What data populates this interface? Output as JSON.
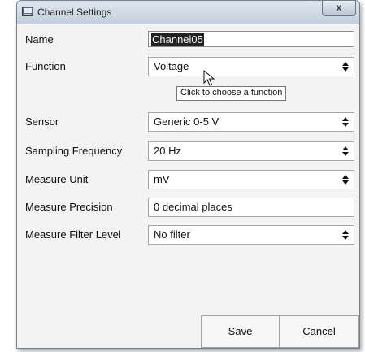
{
  "window": {
    "title": "Channel Settings",
    "close_label": "x"
  },
  "form": {
    "name_label": "Name",
    "name_value": "Channel05",
    "function_label": "Function",
    "function_value": "Voltage",
    "function_tooltip": "Click to choose a function",
    "sensor_label": "Sensor",
    "sensor_value": "Generic 0-5 V",
    "sampling_label": "Sampling Frequency",
    "sampling_value": "20 Hz",
    "unit_label": "Measure Unit",
    "unit_value": "mV",
    "precision_label": "Measure Precision",
    "precision_value": "0 decimal places",
    "filter_label": "Measure Filter Level",
    "filter_value": "No filter"
  },
  "buttons": {
    "save": "Save",
    "cancel": "Cancel"
  },
  "icons": {
    "app": "channel-settings-app-icon",
    "close": "close-icon",
    "dropdown": "up-down-arrows-icon",
    "cursor": "mouse-pointer-icon"
  }
}
